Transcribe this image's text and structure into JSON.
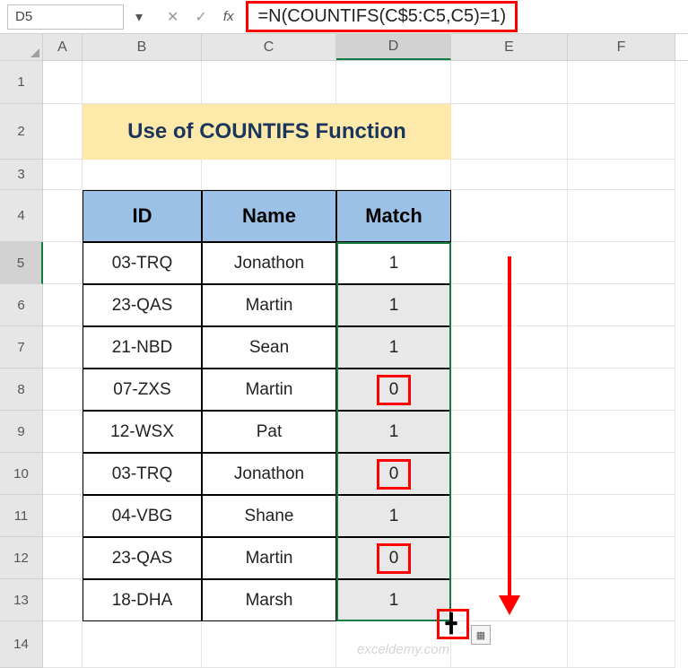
{
  "namebox": "D5",
  "formula": "=N(COUNTIFS(C$5:C5,C5)=1)",
  "fx_label": "fx",
  "cancel_glyph": "✕",
  "check_glyph": "✓",
  "dd_glyph": "▾",
  "columns": {
    "A": "A",
    "B": "B",
    "C": "C",
    "D": "D",
    "E": "E",
    "F": "F"
  },
  "row_labels": {
    "r1": "1",
    "r2": "2",
    "r3": "3",
    "r4": "4",
    "r5": "5",
    "r6": "6",
    "r7": "7",
    "r8": "8",
    "r9": "9",
    "r10": "10",
    "r11": "11",
    "r12": "12",
    "r13": "13",
    "r14": "14"
  },
  "title": "Use of COUNTIFS Function",
  "headers": {
    "id": "ID",
    "name": "Name",
    "match": "Match"
  },
  "rows": [
    {
      "id": "03-TRQ",
      "name": "Jonathon",
      "match": "1"
    },
    {
      "id": "23-QAS",
      "name": "Martin",
      "match": "1"
    },
    {
      "id": "21-NBD",
      "name": "Sean",
      "match": "1"
    },
    {
      "id": "07-ZXS",
      "name": "Martin",
      "match": "0"
    },
    {
      "id": "12-WSX",
      "name": "Pat",
      "match": "1"
    },
    {
      "id": "03-TRQ",
      "name": "Jonathon",
      "match": "0"
    },
    {
      "id": "04-VBG",
      "name": "Shane",
      "match": "1"
    },
    {
      "id": "23-QAS",
      "name": "Martin",
      "match": "0"
    },
    {
      "id": "18-DHA",
      "name": "Marsh",
      "match": "1"
    }
  ],
  "watermark": "exceldemy.com",
  "fillopt_glyph": "▦"
}
